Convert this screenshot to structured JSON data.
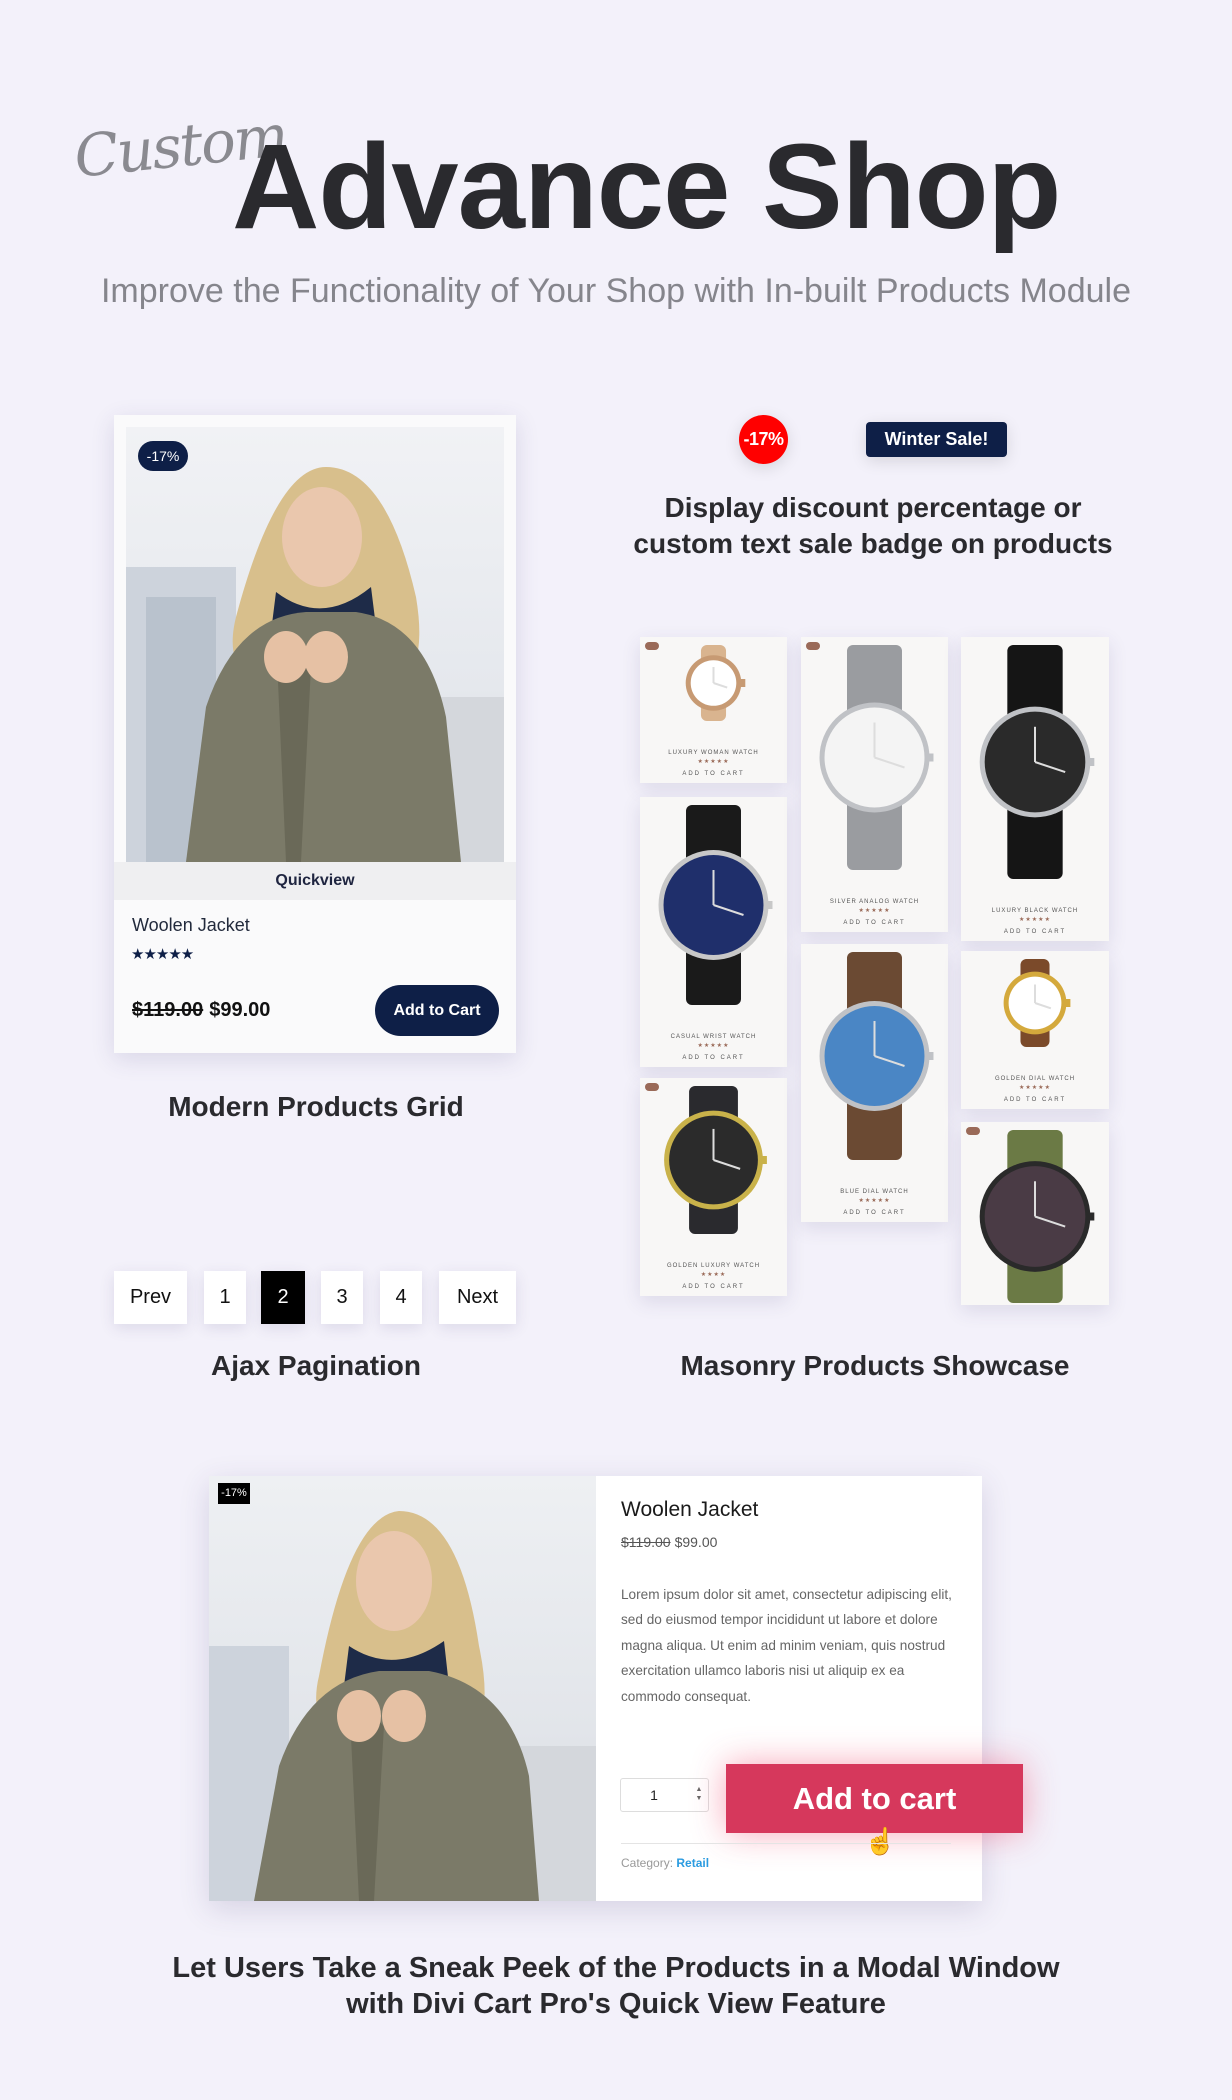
{
  "header": {
    "script_word": "Custom",
    "title": "Advance Shop",
    "subtitle": "Improve the Functionality of Your Shop with In-built Products Module"
  },
  "product_card": {
    "badge": "-17%",
    "image": "woman-in-olive-jacket",
    "quickview_label": "Quickview",
    "title": "Woolen Jacket",
    "rating": 5,
    "rating_max": 5,
    "stars": "★★★★★",
    "old_price": "$119.00",
    "price": "$99.00",
    "add_to_cart_label": "Add to Cart",
    "caption": "Modern Products Grid"
  },
  "badges_demo": {
    "percent_badge": "-17%",
    "text_badge": "Winter Sale!",
    "caption_line1": "Display discount percentage or",
    "caption_line2": "custom text sale badge on products",
    "colors": {
      "percent": "#ff0000",
      "text": "#0e1f47"
    }
  },
  "masonry": {
    "caption": "Masonry Products Showcase",
    "items": [
      {
        "name": "Luxury Woman Watch",
        "stars": "★★★★★",
        "badge": true,
        "cart": "ADD TO CART",
        "watch": "rose-gold-mesh"
      },
      {
        "name": "Casual Wrist Watch",
        "stars": "★★★★★",
        "badge": false,
        "cart": "ADD TO CART",
        "watch": "navy-dial-leather"
      },
      {
        "name": "Golden Luxury Watch",
        "stars": "★★★★",
        "badge": true,
        "cart": "ADD TO CART",
        "watch": "gold-sport"
      },
      {
        "name": "Silver Analog Watch",
        "stars": "★★★★★",
        "badge": true,
        "cart": "ADD TO CART",
        "watch": "silver-steel"
      },
      {
        "name": "Blue Dial Watch",
        "stars": "★★★★★",
        "badge": false,
        "cart": "ADD TO CART",
        "watch": "blue-dial-brown"
      },
      {
        "name": "Luxury Black Watch",
        "stars": "★★★★★",
        "badge": false,
        "cart": "ADD TO CART",
        "watch": "black-chrono"
      },
      {
        "name": "Golden Dial Watch",
        "stars": "★★★★★",
        "badge": false,
        "cart": "ADD TO CART",
        "watch": "gold-white-chrono"
      },
      {
        "name": "",
        "stars": "",
        "badge": true,
        "cart": "",
        "watch": "green-pilot"
      }
    ]
  },
  "pagination": {
    "prev": "Prev",
    "pages": [
      "1",
      "2",
      "3",
      "4"
    ],
    "current": "2",
    "next": "Next",
    "caption": "Ajax Pagination"
  },
  "quick_view_modal": {
    "badge": "-17%",
    "title": "Woolen Jacket",
    "old_price": "$119.00",
    "price": "$99.00",
    "description": "Lorem ipsum dolor sit amet, consectetur adipiscing elit, sed do eiusmod tempor incididunt ut labore et dolore magna aliqua. Ut enim ad minim veniam, quis nostrud exercitation ullamco laboris nisi ut aliquip ex ea commodo consequat.",
    "quantity": "1",
    "add_to_cart_label": "Add to cart",
    "category_label": "Category:",
    "category_value": "Retail",
    "accent_color": "#d6385c"
  },
  "footer_caption": {
    "line1": "Let Users Take a Sneak Peek of the Products in a Modal Window",
    "line2": "with Divi Cart Pro's Quick View Feature"
  }
}
